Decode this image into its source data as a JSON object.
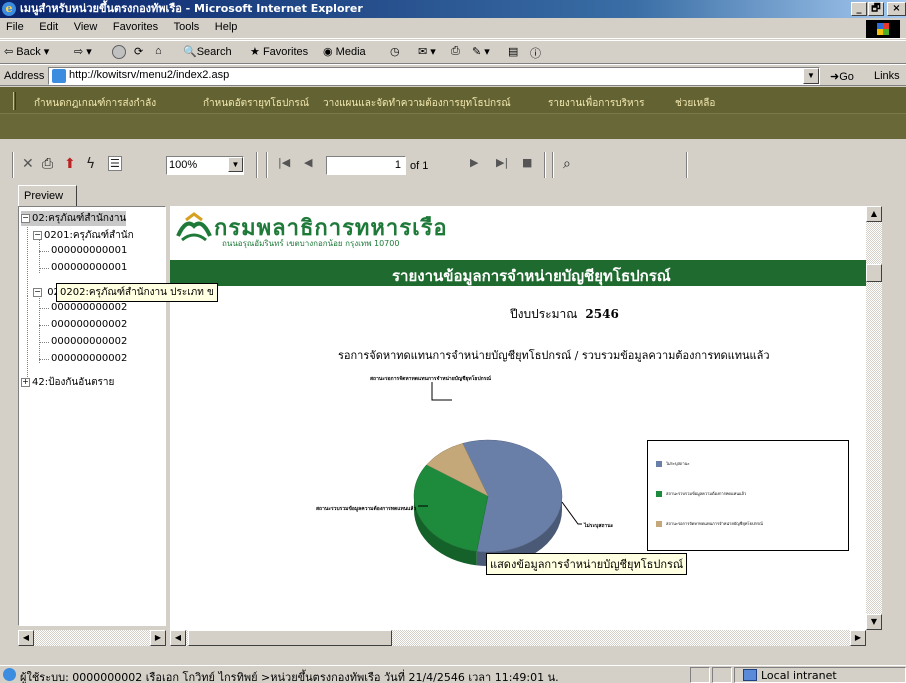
{
  "window": {
    "title": "เมนูสำหรับหน่วยขึ้นตรงกองทัพเรือ - Microsoft Internet Explorer",
    "buttons": [
      "_",
      "🗗",
      "×"
    ]
  },
  "menubar": {
    "items": [
      "File",
      "Edit",
      "View",
      "Favorites",
      "Tools",
      "Help"
    ]
  },
  "toolbar": {
    "back": "Back",
    "search": "Search",
    "favorites": "Favorites",
    "media": "Media"
  },
  "address": {
    "label": "Address",
    "url": "http://kowitsrv/menu2/index2.asp",
    "go": "Go",
    "links": "Links"
  },
  "nav": {
    "items": [
      "กำหนดกฎเกณฑ์การส่งกำลัง",
      "กำหนดอัตรายุทโธปกรณ์",
      "วางแผนและจัดทำความต้องการยุทโธปกรณ์",
      "รายงานเพื่อการบริหาร",
      "ช่วยเหลือ"
    ]
  },
  "report_toolbar": {
    "zoom": "100%",
    "page_current": "1",
    "page_total": "of 1"
  },
  "preview_tab": "Preview",
  "tree": {
    "nodes": [
      {
        "label": "02:ครุภัณฑ์สำนักงาน",
        "toggle": "−"
      },
      {
        "label": "0201:ครุภัณฑ์สำนัก",
        "toggle": "−"
      },
      {
        "label": "000000000001"
      },
      {
        "label": "000000000001"
      },
      {
        "label": "0202:ครุภัณฑ์สำนักงาน ประเภท ข",
        "toggle": "−"
      },
      {
        "label": "000000000002"
      },
      {
        "label": "000000000002"
      },
      {
        "label": "000000000002"
      },
      {
        "label": "000000000002"
      },
      {
        "label": "42:ป้องกันอันตราย",
        "toggle": "+"
      }
    ],
    "tooltip": "0202:ครุภัณฑ์สำนักงาน ประเภท ข"
  },
  "report": {
    "org_name": "กรมพลาธิการทหารเรือ",
    "org_address": "ถนนอรุณอัมรินทร์ เขตบางกอกน้อย กรุงเทพ 10700",
    "title": "รายงานข้อมูลการจำหน่ายบัญชียุทโธปกรณ์",
    "fiscal_label": "ปีงบประมาณ",
    "fiscal_year": "2546",
    "subtitle": "รอการจัดหาทดแทนการจำหน่ายบัญชียุทโธปกรณ์ / รวบรวมข้อมูลความต้องการทดแทนแล้ว",
    "slice_label_top": "สถานะรอการจัดหาทดแทนการจำหน่ายบัญชียุทโธปกรณ์",
    "slice_label_left": "สถานะรวบรวมข้อมูลความต้องการทดแทนแล้ว",
    "slice_label_right": "ไม่ระบุสถานะ",
    "chart_tooltip": "แสดงข้อมูลการจำหน่ายบัญชียุทโธปกรณ์"
  },
  "chart_data": {
    "type": "pie",
    "title": "",
    "slices": [
      {
        "label": "ไม่ระบุสถานะ",
        "value": 58,
        "color": "#6a7fa8"
      },
      {
        "label": "สถานะรวบรวมข้อมูลความต้องการทดแทนแล้ว",
        "value": 32,
        "color": "#1e8a3c"
      },
      {
        "label": "สถานะรอการจัดหาทดแทนการจำหน่ายบัญชียุทโธปกรณ์",
        "value": 10,
        "color": "#c4a87a"
      }
    ],
    "legend_placement": "right"
  },
  "status": {
    "text": "ผู้ใช้ระบบ: 0000000002 เรือเอก โกวิทย์ ไกรทิพย์ >หน่วยขึ้นตรงกองทัพเรือ วันที่ 21/4/2546 เวลา 11:49:01 น.",
    "zone": "Local intranet"
  }
}
